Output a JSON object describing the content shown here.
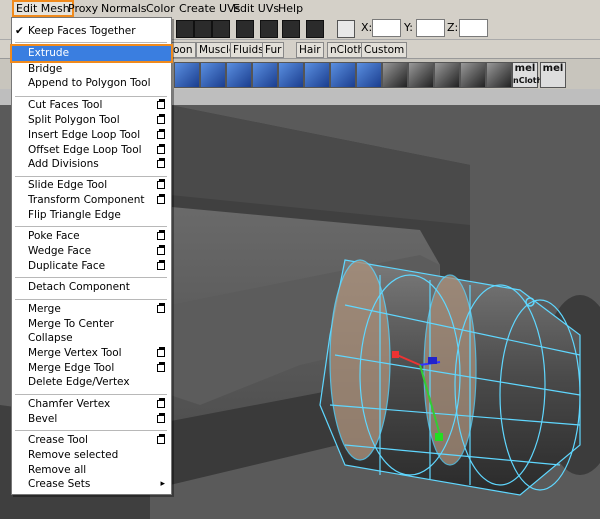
{
  "menubar": {
    "items": [
      "Edit Mesh",
      "Proxy",
      "Normals",
      "Color",
      "Create UVs",
      "Edit UVs",
      "Help"
    ]
  },
  "coords": {
    "x_label": "X:",
    "y_label": "Y:",
    "z_label": "Z:"
  },
  "shelf_tabs": [
    "oon",
    "Muscle",
    "Fluids",
    "Fur",
    "Hair",
    "nCloth",
    "Custom"
  ],
  "shelf": {
    "mel1": "mel",
    "mel2": "mel",
    "ncloth": "nCloth"
  },
  "menu": {
    "keep_faces": "Keep Faces Together",
    "extrude": "Extrude",
    "bridge": "Bridge",
    "append": "Append to Polygon Tool",
    "cut_faces": "Cut Faces Tool",
    "split_polygon": "Split Polygon Tool",
    "insert_edge_loop": "Insert Edge Loop Tool",
    "offset_edge_loop": "Offset Edge Loop Tool",
    "add_divisions": "Add Divisions",
    "slide_edge": "Slide Edge Tool",
    "transform_component": "Transform Component",
    "flip_triangle": "Flip Triangle Edge",
    "poke_face": "Poke Face",
    "wedge_face": "Wedge Face",
    "duplicate_face": "Duplicate Face",
    "detach_component": "Detach Component",
    "merge": "Merge",
    "merge_to_center": "Merge To Center",
    "collapse": "Collapse",
    "merge_vertex": "Merge Vertex Tool",
    "merge_edge": "Merge Edge Tool",
    "delete_edge_vertex": "Delete Edge/Vertex",
    "chamfer_vertex": "Chamfer Vertex",
    "bevel": "Bevel",
    "crease_tool": "Crease Tool",
    "remove_selected": "Remove selected",
    "remove_all": "Remove all",
    "crease_sets": "Crease Sets"
  }
}
